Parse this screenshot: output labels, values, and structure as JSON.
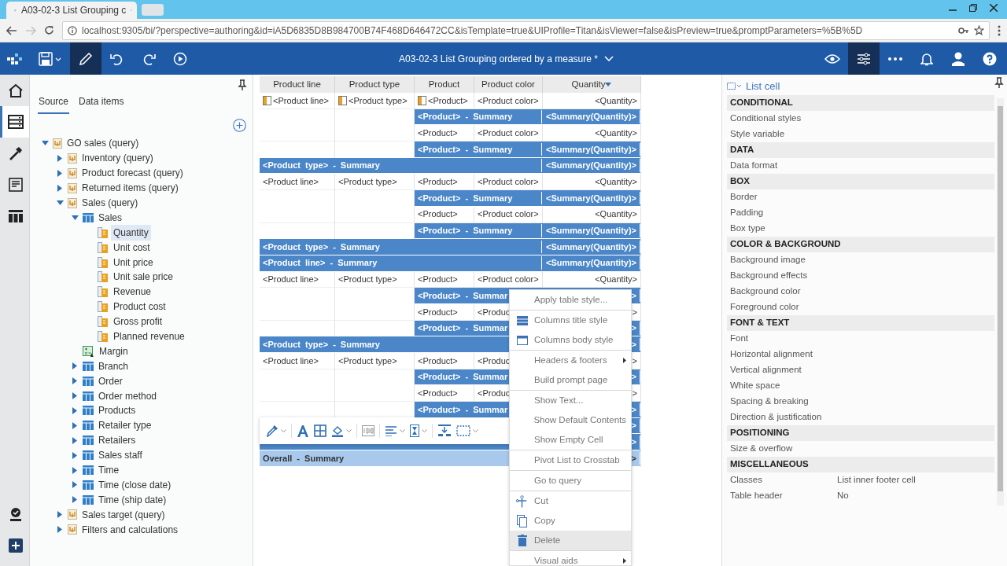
{
  "browser": {
    "tab_title": "A03-02-3 List Grouping c",
    "url": "localhost:9305/bi/?perspective=authoring&id=iA5D6835D8B984700B74F468D646472CC&isTemplate=true&UIProfile=Titan&isViewer=false&isPreview=true&promptParameters=%5B%5D"
  },
  "app_bar": {
    "title": "A03-02-3 List Grouping ordered by a measure *",
    "left_tools": [
      {
        "kind": "save",
        "selected": false
      },
      {
        "kind": "edit",
        "selected": true
      },
      {
        "kind": "undo",
        "selected": false
      },
      {
        "kind": "redo",
        "selected": false
      },
      {
        "kind": "run",
        "selected": false
      }
    ],
    "right_tools": [
      {
        "kind": "preview",
        "selected": false
      },
      {
        "kind": "properties",
        "selected": true
      },
      {
        "kind": "more",
        "selected": false
      },
      {
        "kind": "notifications",
        "selected": false
      },
      {
        "kind": "user",
        "selected": false
      },
      {
        "kind": "help",
        "selected": false
      }
    ]
  },
  "rail": {
    "items": [
      {
        "kind": "home",
        "selected": false
      },
      {
        "kind": "data",
        "selected": true
      },
      {
        "kind": "toolbox",
        "selected": false
      },
      {
        "kind": "pages",
        "selected": false
      },
      {
        "kind": "queries",
        "selected": false
      }
    ],
    "bottom_items": [
      {
        "kind": "validate"
      },
      {
        "kind": "add"
      }
    ]
  },
  "source_panel": {
    "tabs": [
      {
        "label": "Source",
        "selected": true
      },
      {
        "label": "Data items",
        "selected": false
      }
    ],
    "tree": [
      {
        "label": "GO sales (query)",
        "kind": "query",
        "expanded": true,
        "selected": false,
        "children": [
          {
            "label": "Inventory (query)",
            "kind": "query",
            "expanded": false,
            "selected": false
          },
          {
            "label": "Product forecast (query)",
            "kind": "query",
            "expanded": false,
            "selected": false
          },
          {
            "label": "Returned items (query)",
            "kind": "query",
            "expanded": false,
            "selected": false
          },
          {
            "label": "Sales (query)",
            "kind": "query",
            "expanded": true,
            "selected": false,
            "children": [
              {
                "label": "Sales",
                "kind": "table",
                "expanded": true,
                "selected": false,
                "children": [
                  {
                    "label": "Quantity",
                    "kind": "measure",
                    "selected": true
                  },
                  {
                    "label": "Unit cost",
                    "kind": "measure",
                    "selected": false
                  },
                  {
                    "label": "Unit price",
                    "kind": "measure",
                    "selected": false
                  },
                  {
                    "label": "Unit sale price",
                    "kind": "measure",
                    "selected": false
                  },
                  {
                    "label": "Revenue",
                    "kind": "measure",
                    "selected": false
                  },
                  {
                    "label": "Product cost",
                    "kind": "measure",
                    "selected": false
                  },
                  {
                    "label": "Gross profit",
                    "kind": "measure",
                    "selected": false
                  },
                  {
                    "label": "Planned revenue",
                    "kind": "measure",
                    "selected": false
                  }
                ]
              },
              {
                "label": "Margin",
                "kind": "calculation",
                "selected": false
              },
              {
                "label": "Branch",
                "kind": "table",
                "expanded": false,
                "selected": false
              },
              {
                "label": "Order",
                "kind": "table",
                "expanded": false,
                "selected": false
              },
              {
                "label": "Order method",
                "kind": "table",
                "expanded": false,
                "selected": false
              },
              {
                "label": "Products",
                "kind": "table",
                "expanded": false,
                "selected": false
              },
              {
                "label": "Retailer type",
                "kind": "table",
                "expanded": false,
                "selected": false
              },
              {
                "label": "Retailers",
                "kind": "table",
                "expanded": false,
                "selected": false
              },
              {
                "label": "Sales staff",
                "kind": "table",
                "expanded": false,
                "selected": false
              },
              {
                "label": "Time",
                "kind": "table",
                "expanded": false,
                "selected": false
              },
              {
                "label": "Time (close date)",
                "kind": "table",
                "expanded": false,
                "selected": false
              },
              {
                "label": "Time (ship date)",
                "kind": "table",
                "expanded": false,
                "selected": false
              }
            ]
          },
          {
            "label": "Sales target (query)",
            "kind": "query",
            "expanded": false,
            "selected": false
          },
          {
            "label": "Filters and calculations",
            "kind": "query",
            "expanded": false,
            "selected": false
          }
        ]
      }
    ]
  },
  "list": {
    "columns": [
      "Product line",
      "Product type",
      "Product",
      "Product color",
      "Quantity"
    ],
    "rows": [
      {
        "kind": "detail",
        "icons": true,
        "product_line": "<Product line>",
        "product_type": "<Product type>",
        "product": "<Product>",
        "product_color": "<Product color>",
        "quantity": "<Quantity>"
      },
      {
        "kind": "product_summary",
        "label": "<Product> - Summary",
        "quantity": "<Summary(Quantity)>"
      },
      {
        "kind": "detail",
        "icons": false,
        "product": "<Product>",
        "product_color": "<Product color>",
        "quantity": "<Quantity>"
      },
      {
        "kind": "product_summary",
        "label": "<Product> - Summary",
        "quantity": "<Summary(Quantity)>"
      },
      {
        "kind": "type_summary",
        "label": "<Product type> - Summary",
        "quantity": "<Summary(Quantity)>"
      },
      {
        "kind": "detail",
        "icons": false,
        "product_line": "<Product line>",
        "product_type": "<Product type>",
        "product": "<Product>",
        "product_color": "<Product color>",
        "quantity": "<Quantity>"
      },
      {
        "kind": "product_summary",
        "label": "<Product> - Summary",
        "quantity": "<Summary(Quantity)>"
      },
      {
        "kind": "detail",
        "icons": false,
        "product": "<Product>",
        "product_color": "<Product color>",
        "quantity": "<Quantity>"
      },
      {
        "kind": "product_summary",
        "label": "<Product> - Summary",
        "quantity": "<Summary(Quantity)>"
      },
      {
        "kind": "type_summary",
        "label": "<Product type> - Summary",
        "quantity": "<Summary(Quantity)>"
      },
      {
        "kind": "line_summary",
        "label": "<Product line> - Summary",
        "quantity": "<Summary(Quantity)>"
      },
      {
        "kind": "detail",
        "icons": false,
        "product_line": "<Product line>",
        "product_type": "<Product type>",
        "product": "<Product>",
        "product_color": "<Product color>",
        "quantity": "<Quantity>"
      },
      {
        "kind": "product_summary",
        "label": "<Product> - Summar",
        "quantity": ">"
      },
      {
        "kind": "detail",
        "icons": false,
        "product": "<Product>",
        "product_color": "<Produc",
        "quantity": ">"
      },
      {
        "kind": "product_summary",
        "label": "<Product> - Summar",
        "quantity": ">"
      },
      {
        "kind": "type_summary",
        "label": "<Product type> - Summary",
        "quantity": ">"
      },
      {
        "kind": "detail",
        "icons": false,
        "product_line": "<Product line>",
        "product_type": "<Product type>",
        "product": "<Product>",
        "product_color": "<Produc",
        "quantity": ">"
      },
      {
        "kind": "product_summary",
        "label": "<Product> - Summar",
        "quantity": ">"
      },
      {
        "kind": "detail",
        "icons": false,
        "product": "<Product>",
        "product_color": "<Produc",
        "quantity": ">"
      },
      {
        "kind": "product_summary",
        "label": "<Product> - Summar",
        "quantity": ">"
      },
      {
        "kind": "type_summary",
        "quantity": ">"
      },
      {
        "kind": "line_summary",
        "quantity": ">"
      },
      {
        "kind": "overall",
        "label": "Overall - Summary",
        "quantity": ">"
      }
    ]
  },
  "style_toolbar": [
    {
      "kind": "eyedropper",
      "dropdown": true
    },
    {
      "kind": "font",
      "dropdown": false
    },
    {
      "kind": "borders",
      "dropdown": false
    },
    {
      "kind": "fill",
      "dropdown": true
    },
    {
      "kind": "data_format",
      "dropdown": false
    },
    {
      "kind": "align",
      "dropdown": true
    },
    {
      "kind": "vertical_align",
      "dropdown": true
    },
    {
      "kind": "insert",
      "dropdown": false
    },
    {
      "kind": "select_box",
      "dropdown": true
    }
  ],
  "context_menu": [
    [
      {
        "label": "Apply table style...",
        "kind": "plain",
        "hovered": false
      }
    ],
    [
      {
        "label": "Columns title style",
        "kind": "title_style",
        "hovered": false
      },
      {
        "label": "Columns body style",
        "kind": "body_style",
        "hovered": false
      }
    ],
    [
      {
        "label": "Headers & footers",
        "kind": "submenu",
        "hovered": false
      },
      {
        "label": "Build prompt page",
        "kind": "plain",
        "hovered": false
      }
    ],
    [
      {
        "label": "Show Text...",
        "kind": "plain",
        "hovered": false
      },
      {
        "label": "Show Default Contents",
        "kind": "plain",
        "hovered": false
      },
      {
        "label": "Show Empty Cell",
        "kind": "plain",
        "hovered": false
      }
    ],
    [
      {
        "label": "Pivot List to Crosstab",
        "kind": "plain",
        "hovered": false
      }
    ],
    [
      {
        "label": "Go to query",
        "kind": "plain",
        "hovered": false
      }
    ],
    [
      {
        "label": "Cut",
        "kind": "cut",
        "hovered": false
      },
      {
        "label": "Copy",
        "kind": "copy",
        "hovered": false
      },
      {
        "label": "Delete",
        "kind": "delete",
        "hovered": true
      }
    ],
    [
      {
        "label": "Visual aids",
        "kind": "submenu",
        "hovered": false
      }
    ]
  ],
  "properties": {
    "title": "List cell",
    "rows": [
      {
        "kind": "section",
        "label": "CONDITIONAL"
      },
      {
        "kind": "property",
        "label": "Conditional styles"
      },
      {
        "kind": "property",
        "label": "Style variable"
      },
      {
        "kind": "section",
        "label": "DATA"
      },
      {
        "kind": "property",
        "label": "Data format"
      },
      {
        "kind": "section",
        "label": "BOX"
      },
      {
        "kind": "property",
        "label": "Border"
      },
      {
        "kind": "property",
        "label": "Padding"
      },
      {
        "kind": "property",
        "label": "Box type"
      },
      {
        "kind": "section",
        "label": "COLOR & BACKGROUND"
      },
      {
        "kind": "property",
        "label": "Background image"
      },
      {
        "kind": "property",
        "label": "Background effects"
      },
      {
        "kind": "property",
        "label": "Background color"
      },
      {
        "kind": "property",
        "label": "Foreground color"
      },
      {
        "kind": "section",
        "label": "FONT & TEXT"
      },
      {
        "kind": "property",
        "label": "Font"
      },
      {
        "kind": "property",
        "label": "Horizontal alignment"
      },
      {
        "kind": "property",
        "label": "Vertical alignment"
      },
      {
        "kind": "property",
        "label": "White space"
      },
      {
        "kind": "property",
        "label": "Spacing & breaking"
      },
      {
        "kind": "property",
        "label": "Direction & justification"
      },
      {
        "kind": "section",
        "label": "POSITIONING"
      },
      {
        "kind": "property",
        "label": "Size & overflow"
      },
      {
        "kind": "section",
        "label": "MISCELLANEOUS"
      },
      {
        "kind": "property",
        "label": "Classes",
        "value": "List inner footer cell"
      },
      {
        "kind": "property",
        "label": "Table header",
        "value": "No"
      }
    ]
  }
}
